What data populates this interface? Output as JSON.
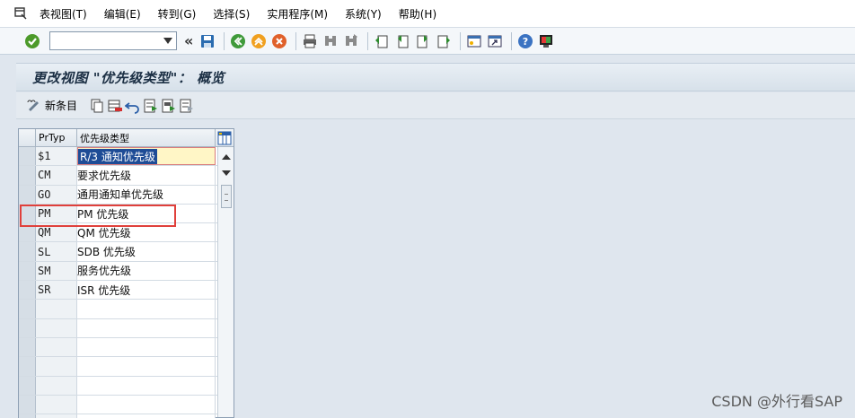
{
  "menubar": {
    "items": [
      "表视图(T)",
      "编辑(E)",
      "转到(G)",
      "选择(S)",
      "实用程序(M)",
      "系统(Y)",
      "帮助(H)"
    ]
  },
  "toolbar": {
    "command_value": "",
    "icons": [
      "enter-check-icon",
      "save-icon",
      "back-icon",
      "exit-icon",
      "cancel-icon",
      "print-icon",
      "find-icon",
      "find-next-icon",
      "first-page-icon",
      "prev-page-icon",
      "next-page-icon",
      "last-page-icon",
      "create-session-icon",
      "shortcut-icon",
      "help-icon",
      "layout-icon"
    ]
  },
  "title": "更改视图 \"优先级类型\"： 概览",
  "app_toolbar": {
    "new_entries_label": "新条目"
  },
  "table": {
    "columns": [
      "PrTyp",
      "优先级类型"
    ],
    "rows": [
      {
        "code": "$1",
        "name": "R/3 通知优先级"
      },
      {
        "code": "CM",
        "name": "要求优先级"
      },
      {
        "code": "GO",
        "name": "通用通知单优先级"
      },
      {
        "code": "PM",
        "name": "PM 优先级"
      },
      {
        "code": "QM",
        "name": "QM 优先级"
      },
      {
        "code": "SL",
        "name": "SDB 优先级"
      },
      {
        "code": "SM",
        "name": "服务优先级"
      },
      {
        "code": "SR",
        "name": "ISR 优先级"
      }
    ],
    "empty_rows": 7
  },
  "watermark": "CSDN @外行看SAP",
  "colors": {
    "accent": "#1e4c96",
    "highlight_border": "#e0403b",
    "active_cell": "#fff6c6"
  }
}
